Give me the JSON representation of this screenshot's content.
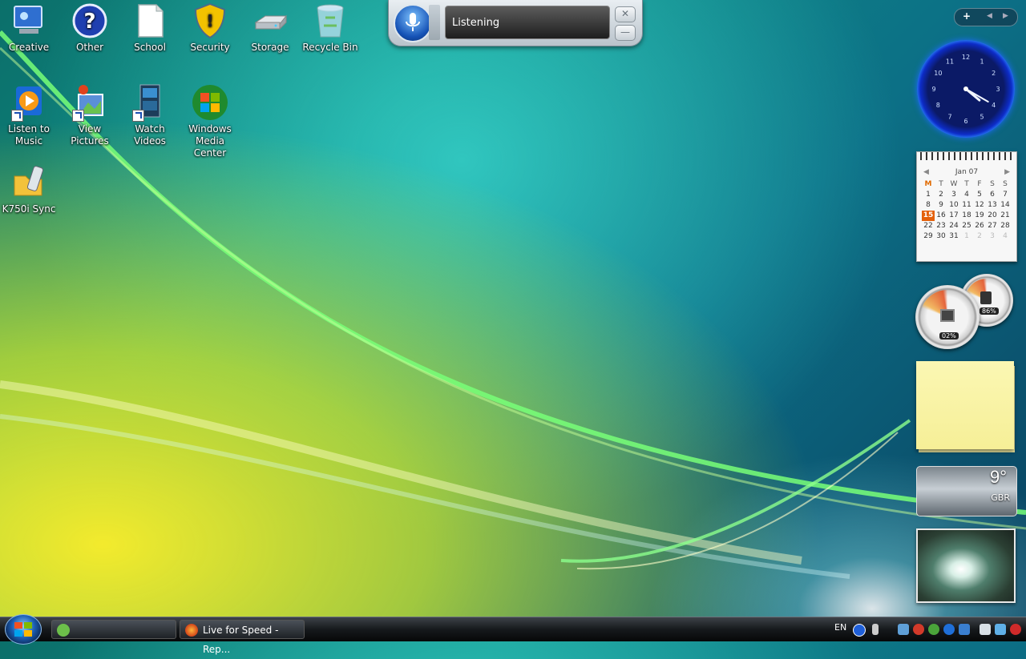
{
  "desktop": {
    "icons": [
      {
        "label": "Creative"
      },
      {
        "label": "Other"
      },
      {
        "label": "School"
      },
      {
        "label": "Security"
      },
      {
        "label": "Storage"
      },
      {
        "label": "Recycle Bin"
      },
      {
        "label": "Listen to Music"
      },
      {
        "label": "View Pictures"
      },
      {
        "label": "Watch Videos"
      },
      {
        "label": "Windows Media Center"
      },
      {
        "label": "K750i Sync"
      }
    ]
  },
  "speech_bar": {
    "status": "Listening",
    "close_glyph": "✕",
    "minimize_glyph": "—"
  },
  "sidebar": {
    "add_glyph": "+",
    "prev_glyph": "◀",
    "next_glyph": "▶",
    "clock": {
      "numbers": [
        "12",
        "1",
        "2",
        "3",
        "4",
        "5",
        "6",
        "7",
        "8",
        "9",
        "10",
        "11"
      ],
      "hour": 4,
      "minute": 20
    },
    "calendar": {
      "month": "Jan 07",
      "prev_glyph": "◀",
      "next_glyph": "▶",
      "weekdays": [
        "M",
        "T",
        "W",
        "T",
        "F",
        "S",
        "S"
      ],
      "weeks": [
        [
          "1",
          "2",
          "3",
          "4",
          "5",
          "6",
          "7"
        ],
        [
          "8",
          "9",
          "10",
          "11",
          "12",
          "13",
          "14"
        ],
        [
          "15",
          "16",
          "17",
          "18",
          "19",
          "20",
          "21"
        ],
        [
          "22",
          "23",
          "24",
          "25",
          "26",
          "27",
          "28"
        ],
        [
          "29",
          "30",
          "31",
          "1",
          "2",
          "3",
          "4"
        ]
      ],
      "today": "15"
    },
    "meters": {
      "cpu": "02%",
      "memory": "86%"
    },
    "weather": {
      "temperature": "9°",
      "location": "GBR"
    }
  },
  "taskbar": {
    "windows": [
      {
        "label": ""
      },
      {
        "label": "Live for Speed - Rep..."
      }
    ],
    "language": "EN"
  },
  "colors": {
    "accent": "#1552b6",
    "calendar_today": "#e4600a"
  }
}
